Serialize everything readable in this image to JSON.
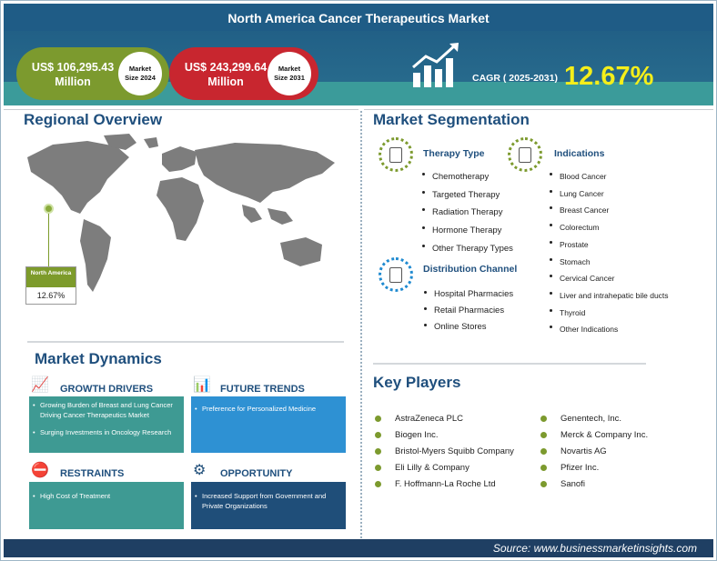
{
  "title": "North America Cancer Therapeutics Market",
  "market_size_2024": {
    "value": "US$ 106,295.43",
    "unit": "Million",
    "badge_line1": "Market",
    "badge_line2": "Size 2024"
  },
  "market_size_2031": {
    "value": "US$ 243,299.64",
    "unit": "Million",
    "badge_line1": "Market",
    "badge_line2": "Size 2031"
  },
  "cagr": {
    "label": "CAGR ( 2025-2031)",
    "value": "12.67%"
  },
  "regional": {
    "title": "Regional Overview",
    "region_label": "North America",
    "region_value": "12.67%"
  },
  "segmentation": {
    "title": "Market Segmentation",
    "therapy_type": {
      "heading": "Therapy Type",
      "items": [
        "Chemotherapy",
        "Targeted Therapy",
        "Radiation Therapy",
        "Hormone Therapy",
        "Other Therapy Types"
      ]
    },
    "distribution_channel": {
      "heading": "Distribution Channel",
      "items": [
        "Hospital Pharmacies",
        "Retail Pharmacies",
        "Online Stores"
      ]
    },
    "indications": {
      "heading": "Indications",
      "items": [
        "Blood Cancer",
        "Lung Cancer",
        "Breast Cancer",
        "Colorectum",
        "Prostate",
        "Stomach",
        "Cervical Cancer",
        "Liver and intrahepatic bile ducts",
        "Thyroid",
        "Other Indications"
      ]
    }
  },
  "dynamics": {
    "title": "Market Dynamics",
    "growth_drivers": {
      "heading": "GROWTH DRIVERS",
      "items": [
        "Growing Burden of Breast and Lung Cancer Driving Cancer Therapeutics Market",
        "Surging Investments in Oncology Research"
      ]
    },
    "future_trends": {
      "heading": "FUTURE TRENDS",
      "items": [
        "Preference for Personalized Medicine"
      ]
    },
    "restraints": {
      "heading": "RESTRAINTS",
      "items": [
        "High Cost of Treatment"
      ]
    },
    "opportunity": {
      "heading": "OPPORTUNITY",
      "items": [
        "Increased Support from Government and Private Organizations"
      ]
    }
  },
  "key_players": {
    "title": "Key Players",
    "left": [
      "AstraZeneca PLC",
      "Biogen Inc.",
      "Bristol-Myers Squibb Company",
      "Eli Lilly & Company",
      "F. Hoffmann-La Roche Ltd"
    ],
    "right": [
      "Genentech, Inc.",
      "Merck & Company Inc.",
      "Novartis AG",
      "Pfizer Inc.",
      "Sanofi"
    ]
  },
  "footer": {
    "source": "Source: www.businessmarketinsights.com"
  },
  "colors": {
    "navy": "#1f5c86",
    "green": "#7c9a2e",
    "red": "#c8262f",
    "teal": "#3e9a93",
    "blue": "#2e91d3",
    "cagr_yellow": "#f4ee1a"
  }
}
